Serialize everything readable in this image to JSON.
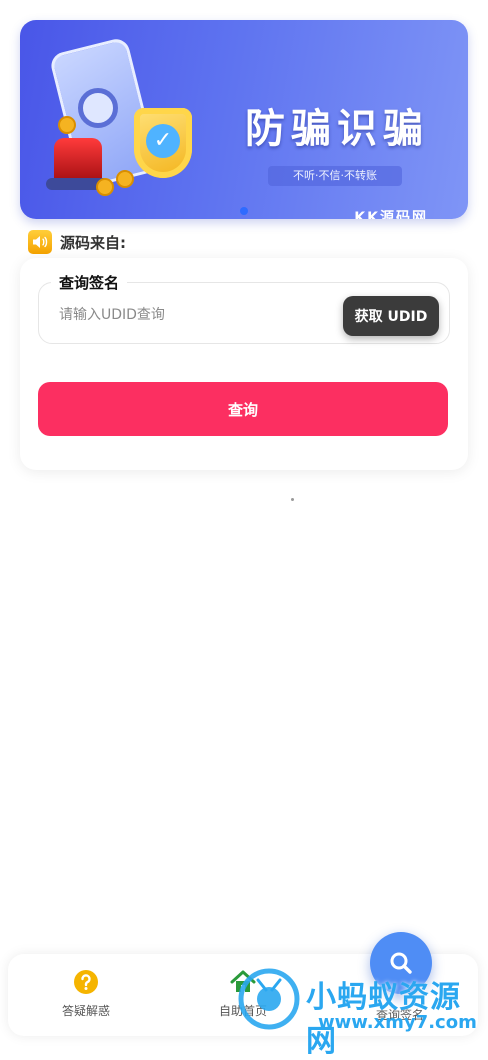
{
  "banner": {
    "title": "防骗识骗",
    "subtitle": "不听·不信·不转账",
    "brand": "KK源码网"
  },
  "notice": {
    "label": "源码来自:",
    "icon": "speaker-icon"
  },
  "query_form": {
    "legend": "查询签名",
    "placeholder": "请输入UDID查询",
    "get_udid_label": "获取 UDID",
    "query_button_label": "查询"
  },
  "tabbar": {
    "items": [
      {
        "label": "答疑解惑",
        "icon": "question-icon",
        "color": "#f5b400"
      },
      {
        "label": "自助首页",
        "icon": "home-icon",
        "color": "#2a9a3a"
      },
      {
        "label": "查询签名",
        "icon": "search-icon",
        "color": "#4f8df5"
      }
    ]
  },
  "watermark": {
    "title": "小蚂蚁资源网",
    "url": "www.xmy7.com"
  },
  "colors": {
    "primary_button": "#fc2f61",
    "dark_button": "#3b3b3b",
    "fab": "#4f8df5"
  }
}
